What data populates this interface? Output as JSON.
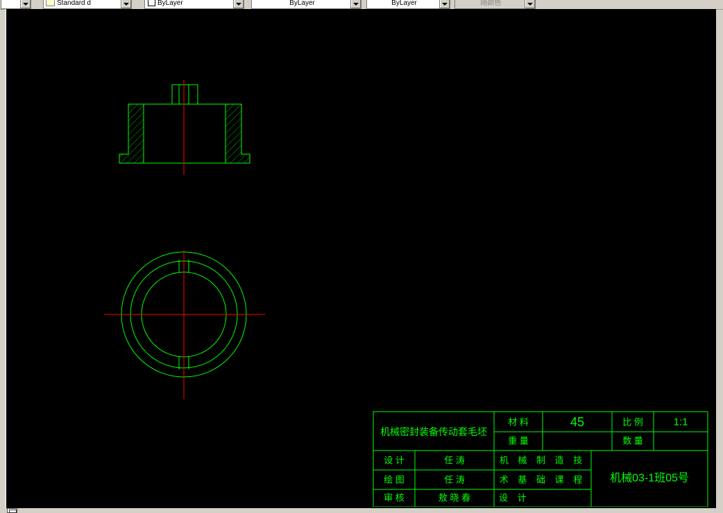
{
  "toolbar": {
    "style_combo": "Standard d",
    "color_combo": "ByLayer",
    "linetype_combo": "ByLayer",
    "lineweight_combo": "ByLayer",
    "plotstyle_combo": "随颜色"
  },
  "colors": {
    "geometry": "#00ff00",
    "centerline": "#ff0000",
    "canvas_background": "#000000",
    "chrome": "#d4d0c8"
  },
  "title_block": {
    "part_name": "机械密封装备传动套毛坯",
    "material_label": "材  料",
    "material_value": "45",
    "scale_label": "比  例",
    "scale_value": "1:1",
    "weight_label": "重  量",
    "quantity_label": "数  量",
    "design_label": "设  计",
    "design_value": "任  涛",
    "draft_label": "绘  图",
    "draft_value": "任  涛",
    "check_label": "审  核",
    "check_value": "敖 晓 春",
    "course_line1": "机 械 制 造 技",
    "course_line2": "术 基 础 课 程",
    "course_line3": "设  计",
    "class_id": "机械03-1班05号"
  }
}
